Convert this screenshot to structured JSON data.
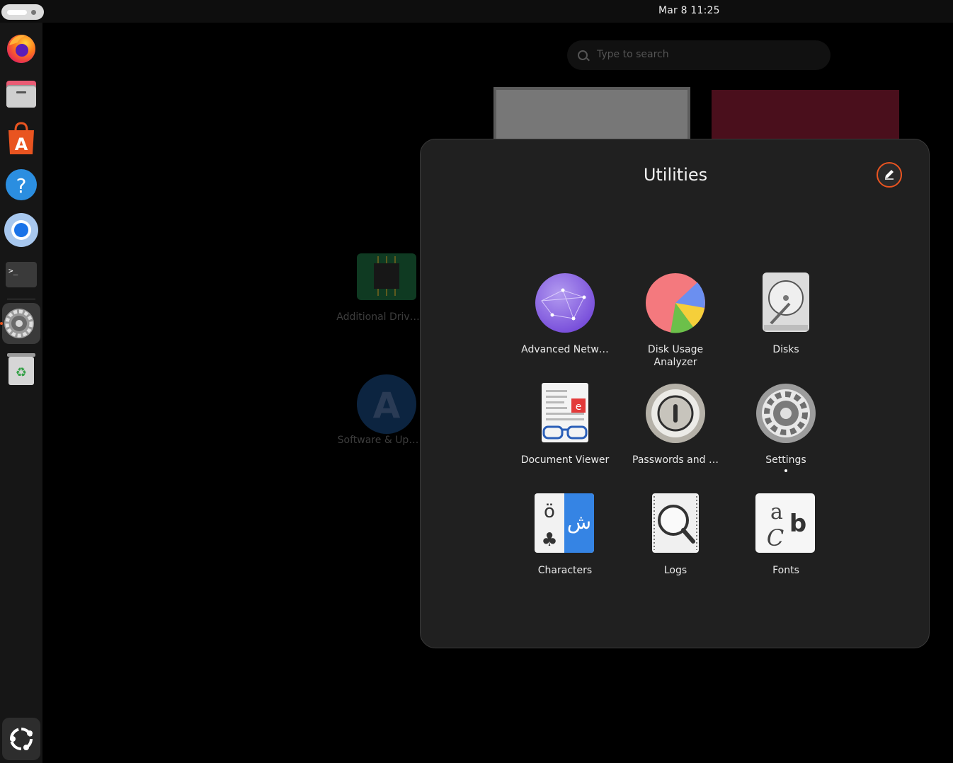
{
  "topbar": {
    "clock": "Mar 8  11:25",
    "activities_icon": "workspace-indicator-icon"
  },
  "dock": {
    "items": [
      {
        "name": "firefox",
        "icon": "firefox-icon"
      },
      {
        "name": "files",
        "icon": "files-icon"
      },
      {
        "name": "app-center",
        "icon": "app-center-icon"
      },
      {
        "name": "help",
        "icon": "help-icon"
      },
      {
        "name": "chromium",
        "icon": "chromium-icon"
      },
      {
        "name": "terminal",
        "icon": "terminal-icon"
      },
      {
        "name": "settings",
        "icon": "settings-icon"
      },
      {
        "name": "trash",
        "icon": "trash-icon"
      }
    ],
    "show_apps_icon": "ubuntu-logo-icon"
  },
  "overview": {
    "search_placeholder": "Type to search",
    "background_apps": [
      {
        "label": "Additional Driv…",
        "icon": "chip-icon"
      },
      {
        "label": "Software & Up…",
        "icon": "software-updates-icon"
      }
    ]
  },
  "folder": {
    "title": "Utilities",
    "edit_icon": "pencil-icon",
    "apps": [
      {
        "label": "Advanced Netw…",
        "icon": "network-globe-icon"
      },
      {
        "label": "Disk Usage\nAnalyzer",
        "icon": "pie-chart-icon"
      },
      {
        "label": "Disks",
        "icon": "harddisk-icon"
      },
      {
        "label": "Document Viewer",
        "icon": "document-viewer-icon"
      },
      {
        "label": "Passwords and …",
        "icon": "keyhole-icon"
      },
      {
        "label": "Settings",
        "icon": "settings-gear-icon",
        "running": true
      },
      {
        "label": "Characters",
        "icon": "characters-icon"
      },
      {
        "label": "Logs",
        "icon": "logs-magnifier-icon"
      },
      {
        "label": "Fonts",
        "icon": "fonts-icon"
      }
    ]
  },
  "colors": {
    "accent": "#e95420",
    "panel": "#202020",
    "dock": "#161616"
  }
}
